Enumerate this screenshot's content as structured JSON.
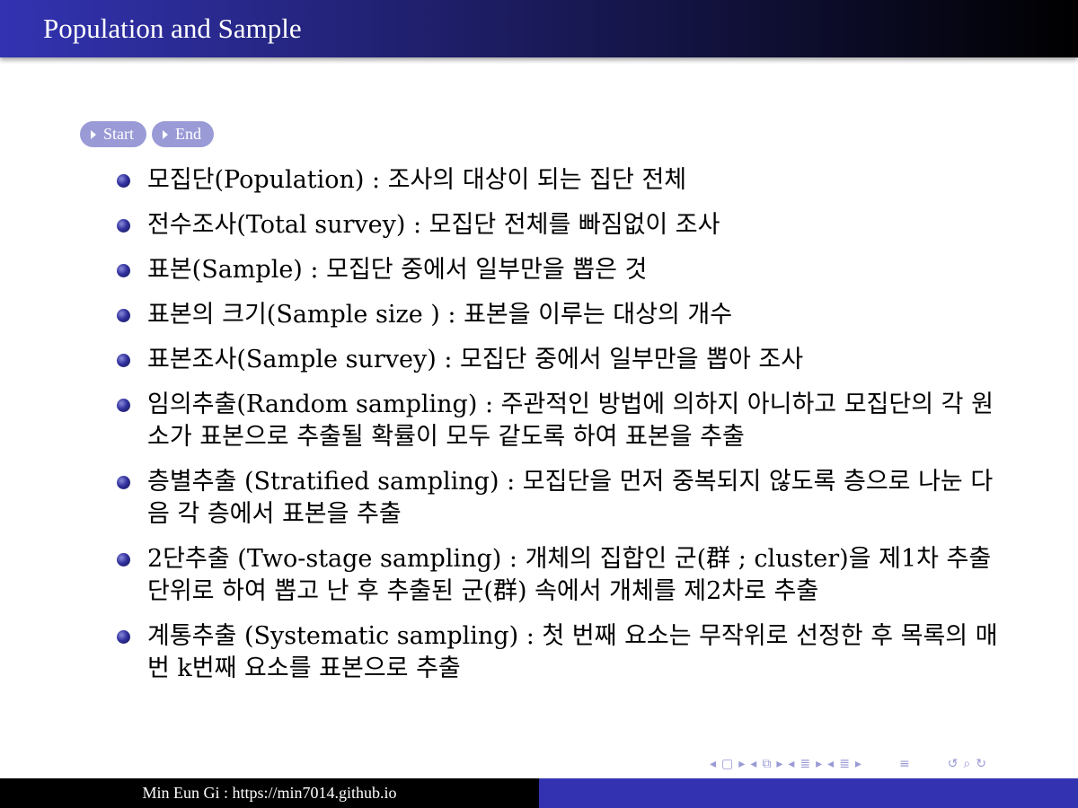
{
  "slide": {
    "title": "Population and Sample"
  },
  "nav_buttons": [
    {
      "label": "Start"
    },
    {
      "label": "End"
    }
  ],
  "items": [
    {
      "text": "모집단(Population) : 조사의 대상이 되는 집단 전체"
    },
    {
      "text": "전수조사(Total survey) : 모집단 전체를 빠짐없이 조사"
    },
    {
      "text": "표본(Sample) : 모집단 중에서 일부만을 뽑은 것"
    },
    {
      "text": "표본의 크기(Sample size ) : 표본을 이루는 대상의 개수"
    },
    {
      "text": "표본조사(Sample survey) : 모집단 중에서 일부만을 뽑아 조사"
    },
    {
      "text": "임의추출(Random sampling) : 주관적인 방법에 의하지 아니하고 모집단의 각 원소가 표본으로 추출될 확률이 모두 같도록 하여 표본을 추출"
    },
    {
      "text": "층별추출 (Stratified sampling) : 모집단을 먼저 중복되지 않도록 층으로 나눈 다음 각 층에서 표본을 추출"
    },
    {
      "text": "2단추출 (Two-stage sampling) : 개체의 집합인 군(群 ; cluster)을 제1차 추출단위로 하여 뽑고 난 후 추출된 군(群) 속에서 개체를 제2차로 추출"
    },
    {
      "text": "계통추출 (Systematic sampling) : 첫 번째 요소는 무작위로 선정한 후 목록의 매번 k번째 요소를 표본으로 추출"
    }
  ],
  "footer": {
    "author_url": "Min Eun Gi : https://min7014.github.io"
  },
  "beamer_nav": {
    "icons": [
      "nav-prev-icon",
      "frame-icon",
      "nav-next-icon",
      "subsection-icon",
      "section-icon",
      "align-icon",
      "search-icon"
    ]
  },
  "colors": {
    "title_gradient_start": "#3333b2",
    "title_gradient_end": "#000000",
    "nav_button": "#9a9ad6",
    "footer_right": "#3333b2"
  }
}
